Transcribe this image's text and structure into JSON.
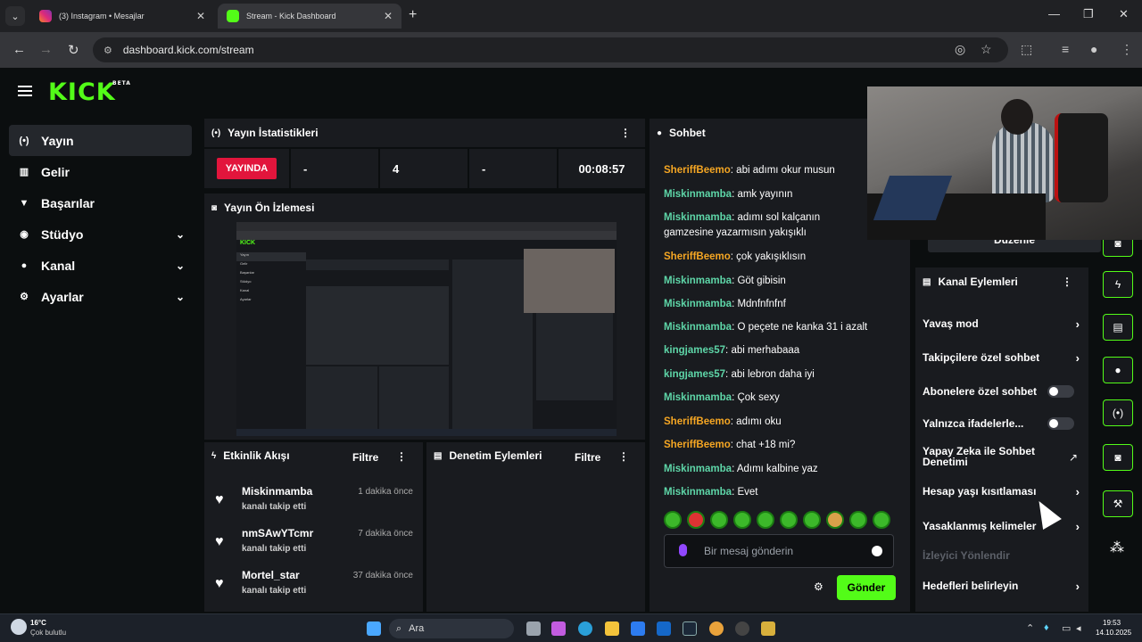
{
  "browser": {
    "tabs": [
      {
        "title": "(3) Instagram • Mesajlar",
        "active": false
      },
      {
        "title": "Stream - Kick Dashboard",
        "active": true
      }
    ],
    "url": "dashboard.kick.com/stream"
  },
  "app": {
    "logo": "KICK",
    "logo_badge": "BETA",
    "sidebar": [
      {
        "label": "Yayın",
        "icon": "broadcast-icon",
        "active": true,
        "chevron": false
      },
      {
        "label": "Gelir",
        "icon": "chart-icon",
        "active": false,
        "chevron": false
      },
      {
        "label": "Başarılar",
        "icon": "trophy-icon",
        "active": false,
        "chevron": false
      },
      {
        "label": "Stüdyo",
        "icon": "studio-icon",
        "active": false,
        "chevron": true
      },
      {
        "label": "Kanal",
        "icon": "users-icon",
        "active": false,
        "chevron": true
      },
      {
        "label": "Ayarlar",
        "icon": "gear-icon",
        "active": false,
        "chevron": true
      }
    ]
  },
  "stats": {
    "title": "Yayın İstatistikleri",
    "live_badge": "YAYINDA",
    "cells": [
      "-",
      "4",
      "-",
      "00:08:57"
    ]
  },
  "preview": {
    "title": "Yayın Ön İzlemesi"
  },
  "activity": {
    "title": "Etkinlik Akışı",
    "filter": "Filtre",
    "events": [
      {
        "user": "Miskinmamba",
        "action": "kanalı takip etti",
        "time": "1 dakika önce"
      },
      {
        "user": "nmSAwYTcmr",
        "action": "kanalı takip etti",
        "time": "7 dakika önce"
      },
      {
        "user": "Mortel_star",
        "action": "kanalı takip etti",
        "time": "37 dakika önce"
      }
    ]
  },
  "moderation": {
    "title": "Denetim Eylemleri",
    "filter": "Filtre"
  },
  "chat": {
    "title": "Sohbet",
    "messages": [
      {
        "user": "SheriffBeemo",
        "text": "abi adımı okur musun",
        "color": "#f5a623"
      },
      {
        "user": "Miskinmamba",
        "text": "amk yayının",
        "color": "#5ed6a8"
      },
      {
        "user": "Miskinmamba",
        "text": "adımı sol kalçanın gamzesine yazarmısın yakışıklı",
        "color": "#5ed6a8"
      },
      {
        "user": "SheriffBeemo",
        "text": "çok yakışıklısın",
        "color": "#f5a623"
      },
      {
        "user": "Miskinmamba",
        "text": "Göt gibisin",
        "color": "#5ed6a8"
      },
      {
        "user": "Miskinmamba",
        "text": "Mdnfnfnfnf",
        "color": "#5ed6a8"
      },
      {
        "user": "Miskinmamba",
        "text": "O peçete ne kanka 31 i azalt",
        "color": "#5ed6a8"
      },
      {
        "user": "kingjames57",
        "text": "abi merhabaaa",
        "color": "#5ed6a8"
      },
      {
        "user": "kingjames57",
        "text": "abi lebron daha iyi",
        "color": "#5ed6a8"
      },
      {
        "user": "Miskinmamba",
        "text": "Çok sexy",
        "color": "#5ed6a8"
      },
      {
        "user": "SheriffBeemo",
        "text": "adımı oku",
        "color": "#f5a623"
      },
      {
        "user": "SheriffBeemo",
        "text": "chat +18 mi?",
        "color": "#f5a623"
      },
      {
        "user": "Miskinmamba",
        "text": "Adımı kalbine yaz",
        "color": "#5ed6a8"
      },
      {
        "user": "Miskinmamba",
        "text": "Evet",
        "color": "#5ed6a8"
      }
    ],
    "input_placeholder": "Bir mesaj gönderin",
    "send_label": "Gönder"
  },
  "actions": {
    "edit_label": "Düzenle",
    "title": "Kanal Eylemleri",
    "items": [
      {
        "label": "Yavaş mod",
        "type": "chevron"
      },
      {
        "label": "Takipçilere özel sohbet",
        "type": "chevron"
      },
      {
        "label": "Abonelere özel sohbet",
        "type": "toggle",
        "on": false
      },
      {
        "label": "Yalnızca ifadelerle...",
        "type": "toggle",
        "on": false
      },
      {
        "label": "Yapay Zeka ile Sohbet Denetimi",
        "type": "external"
      },
      {
        "label": "Hesap yaşı kısıtlaması",
        "type": "chevron"
      },
      {
        "label": "Yasaklanmış kelimeler",
        "type": "chevron"
      },
      {
        "label": "İzleyici Yönlendir",
        "type": "disabled"
      },
      {
        "label": "Hedefleri belirleyin",
        "type": "chevron"
      }
    ]
  },
  "taskbar": {
    "weather_temp": "16°C",
    "weather_desc": "Çok bulutlu",
    "search": "Ara",
    "time": "19:53",
    "date": "14.10.2025"
  }
}
